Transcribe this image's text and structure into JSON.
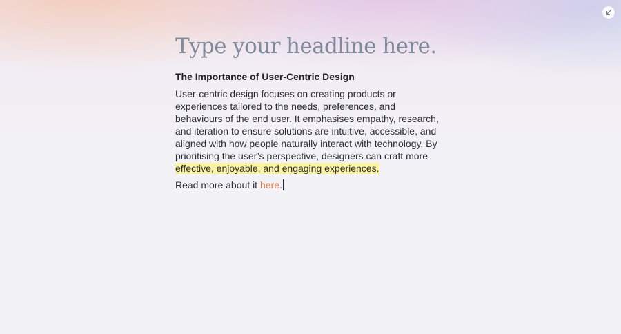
{
  "document": {
    "headline": "Type your headline here.",
    "subheading": "The Importance of User-Centric Design",
    "paragraph": {
      "text_before_highlight": "User-centric design focuses on creating products or experiences tailored to the needs, preferences, and behaviours of the end user. It emphasises empathy, research, and iteration to ensure solutions are intuitive, accessible, and aligned with how people naturally interact with technology. By prioritising the user’s perspective, designers can craft more ",
      "highlighted_text": "effective, enjoyable, and engaging experiences."
    },
    "read_more": {
      "prefix": "Read more about it ",
      "link_text": "here",
      "suffix": "."
    }
  },
  "controls": {
    "collapse_icon": "arrow-down-left-icon"
  },
  "colors": {
    "headline": "#7f8a9c",
    "link": "#e0773f",
    "highlight": "#fbf3a4",
    "body_text": "#2b2d33"
  }
}
